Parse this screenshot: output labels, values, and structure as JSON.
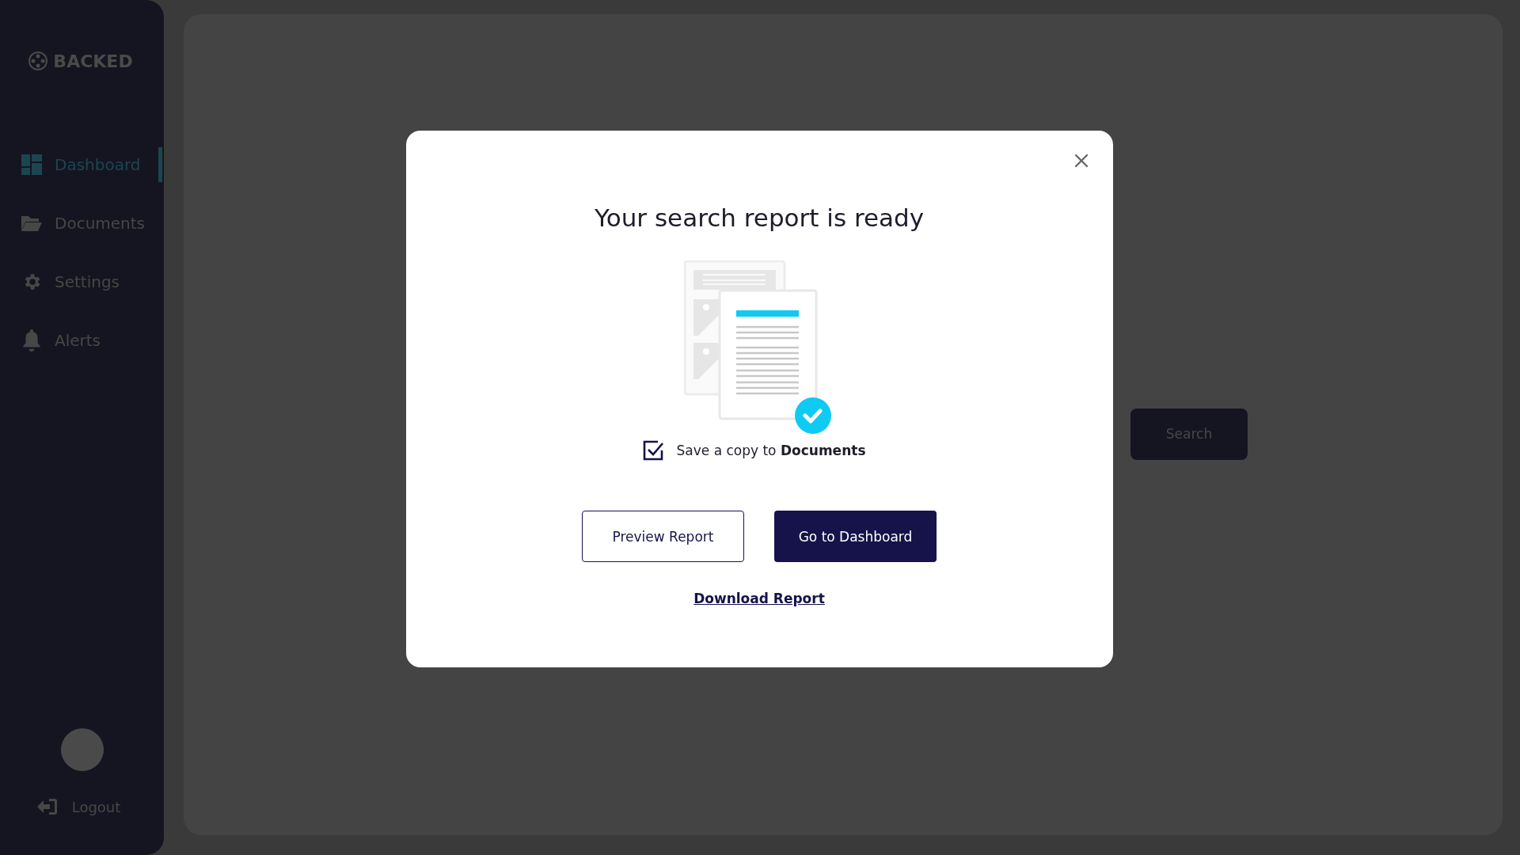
{
  "sidebar": {
    "logo": "BACKED",
    "items": [
      {
        "kind": "dashboard",
        "label": "Dashboard",
        "selected": true
      },
      {
        "kind": "documents",
        "label": "Documents",
        "selected": false
      },
      {
        "kind": "settings",
        "label": "Settings",
        "selected": false
      },
      {
        "kind": "alerts",
        "label": "Alerts",
        "selected": false
      }
    ],
    "logout": "Logout"
  },
  "main": {
    "search_button": "Search"
  },
  "modal": {
    "title": "Your search report is ready",
    "save_copy": {
      "checked": true,
      "label": "Save a copy to **Documents**"
    },
    "buttons": [
      {
        "kind": "outline",
        "label": "Preview Report"
      },
      {
        "kind": "primary",
        "label": "Go to Dashboard"
      }
    ],
    "link": "Download Report"
  }
}
